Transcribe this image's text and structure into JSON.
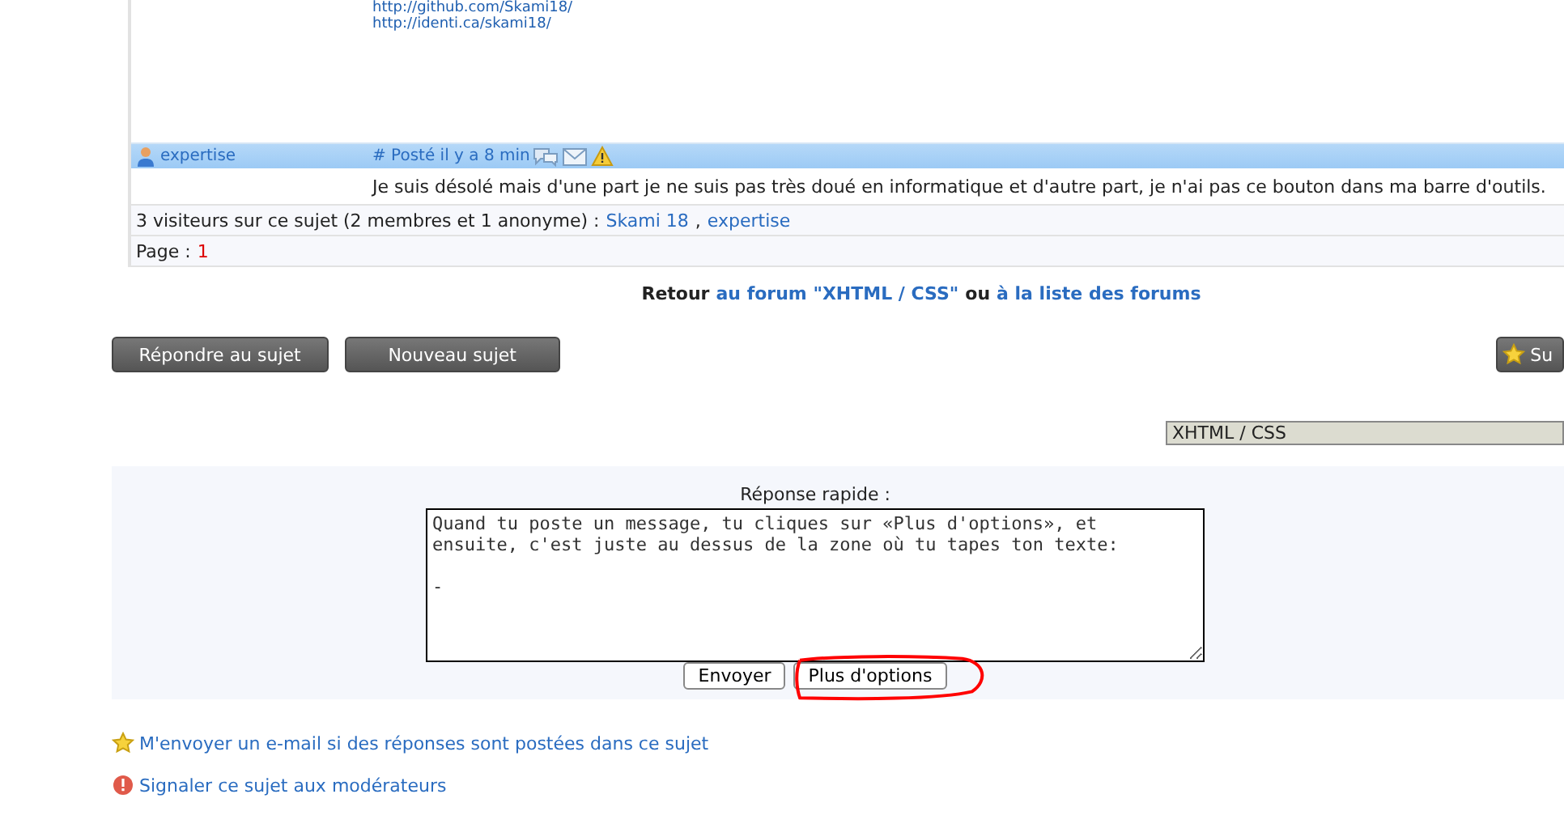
{
  "post": {
    "links": [
      "http://github.com/Skami18/",
      "http://identi.ca/skami18/"
    ]
  },
  "reply": {
    "author": "expertise",
    "posted": "# Posté il y a 8 min",
    "message": "Je suis désolé mais d'une part je ne suis pas très doué en informatique et d'autre part, je n'ai pas ce bouton dans ma barre d'outils."
  },
  "visitors": {
    "text": "3 visiteurs sur ce sujet (2 membres et 1 anonyme) :",
    "members": [
      "Skami 18",
      "expertise"
    ],
    "separator": ","
  },
  "pagination": {
    "label": "Page :",
    "pages": [
      {
        "label": "1",
        "selected": true
      }
    ]
  },
  "back": {
    "prefix": "Retour",
    "forum_link": "au forum \"XHTML / CSS\"",
    "middle": "ou",
    "list_link": "à la liste des forums"
  },
  "actions": [
    "Répondre au sujet",
    "Nouveau sujet"
  ],
  "follow_button": "Su",
  "forum_select": {
    "value": "XHTML / CSS"
  },
  "quick_reply": {
    "label": "Réponse rapide :",
    "value": "Quand tu poste un message, tu cliques sur «Plus d'options», et\nensuite, c'est juste au dessus de la zone où tu tapes ton texte:\n\n-",
    "buttons": [
      {
        "label": "Envoyer",
        "circled": false
      },
      {
        "label": "Plus d'options",
        "circled": true
      }
    ]
  },
  "footer_links": [
    {
      "kind": "star",
      "label": "M'envoyer un e-mail si des réponses sont postées dans ce sujet"
    },
    {
      "kind": "alert",
      "label": "Signaler ce sujet aux modérateurs"
    }
  ]
}
